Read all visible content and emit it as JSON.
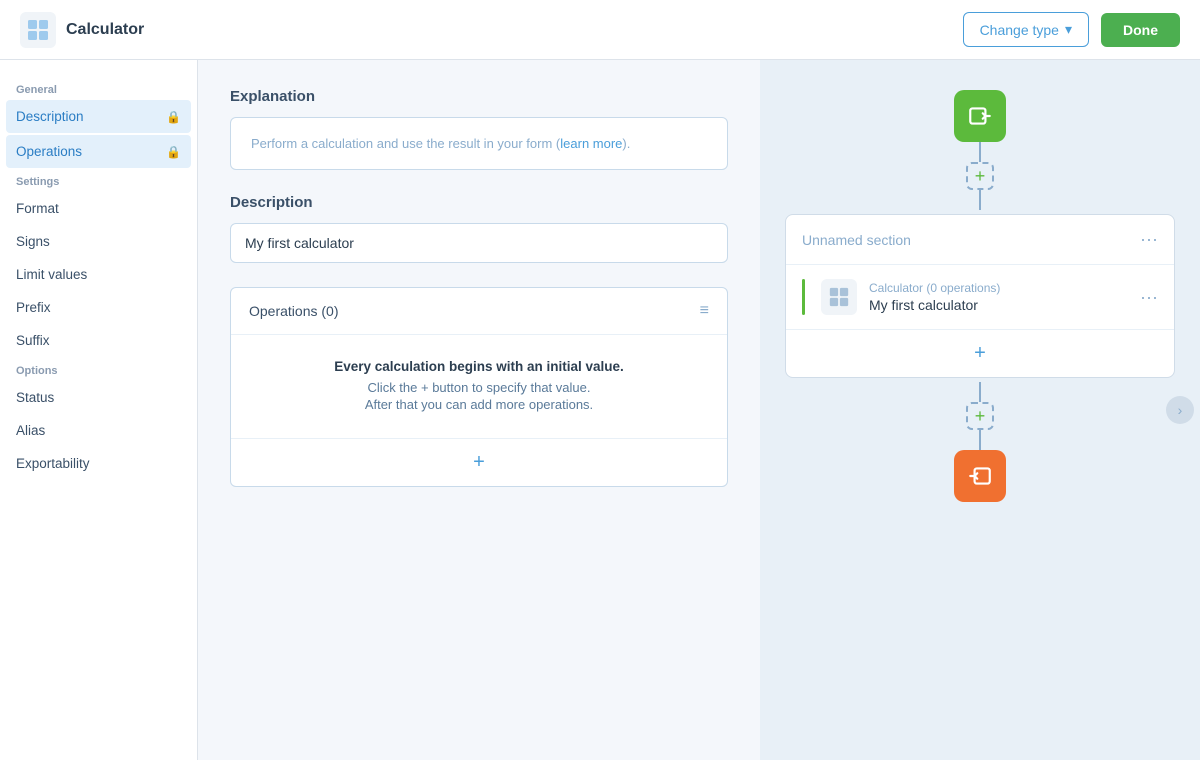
{
  "header": {
    "logo_text": "Calculator",
    "change_type_label": "Change type",
    "done_label": "Done"
  },
  "sidebar": {
    "general_label": "General",
    "description_label": "Description",
    "operations_label": "Operations",
    "settings_label": "Settings",
    "format_label": "Format",
    "signs_label": "Signs",
    "limit_values_label": "Limit values",
    "prefix_label": "Prefix",
    "suffix_label": "Suffix",
    "options_label": "Options",
    "status_label": "Status",
    "alias_label": "Alias",
    "exportability_label": "Exportability"
  },
  "main": {
    "explanation_title": "Explanation",
    "explanation_text": "Perform a calculation and use the result in your form (",
    "explanation_link": "learn more",
    "explanation_suffix": ").",
    "description_title": "Description",
    "description_value": "My first calculator",
    "operations_title": "Operations (0)",
    "operations_empty_line1": "Every calculation begins with an initial value.",
    "operations_empty_line2": "Click the + button to specify that value.",
    "operations_empty_line3": "After that you can add more operations."
  },
  "flow": {
    "section_title": "Unnamed section",
    "calc_name": "Calculator (0 operations)",
    "calc_value": "My first calculator"
  }
}
